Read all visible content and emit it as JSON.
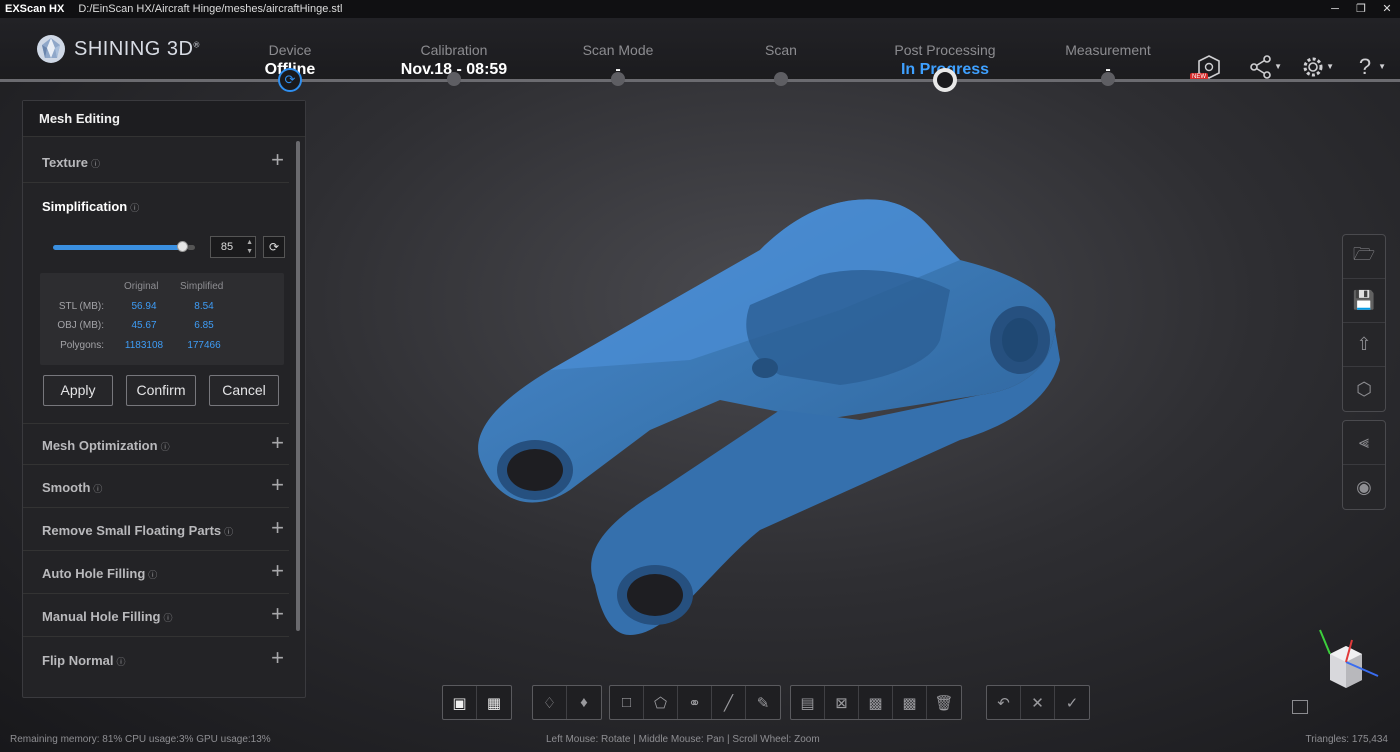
{
  "titlebar": {
    "app_name": "EXScan HX",
    "path": "D:/EinScan HX/Aircraft Hinge/meshes/aircraftHinge.stl",
    "controls": [
      "minimize-icon",
      "restore-icon",
      "close-icon"
    ]
  },
  "logo": {
    "text": "SHINING 3D",
    "mark": "®"
  },
  "workflow": {
    "steps": [
      {
        "label": "Device",
        "value": "Offline"
      },
      {
        "label": "Calibration",
        "value": "Nov.18 - 08:59"
      },
      {
        "label": "Scan Mode",
        "value": "-"
      },
      {
        "label": "Scan",
        "value": ""
      },
      {
        "label": "Post Processing",
        "value": "In Progress"
      },
      {
        "label": "Measurement",
        "value": "-"
      }
    ]
  },
  "top_icons": [
    {
      "icon": "new-features-icon",
      "badge": "NEW"
    },
    {
      "icon": "share-icon"
    },
    {
      "icon": "settings-gear-icon"
    },
    {
      "icon": "help-icon"
    }
  ],
  "panel": {
    "title": "Mesh Editing",
    "sections": [
      {
        "name": "Texture"
      },
      {
        "name": "Simplification"
      },
      {
        "name": "Mesh Optimization"
      },
      {
        "name": "Smooth"
      },
      {
        "name": "Remove Small Floating Parts"
      },
      {
        "name": "Auto Hole Filling"
      },
      {
        "name": "Manual Hole Filling"
      },
      {
        "name": "Flip Normal"
      }
    ],
    "simplification": {
      "slider_value": "85",
      "slider_fraction": 0.85,
      "headers": {
        "original": "Original",
        "simplified": "Simplified"
      },
      "rows": [
        {
          "label": "STL (MB):",
          "original": "56.94",
          "simplified": "8.54"
        },
        {
          "label": "OBJ (MB):",
          "original": "45.67",
          "simplified": "6.85"
        },
        {
          "label": "Polygons:",
          "original": "1183108",
          "simplified": "177466"
        }
      ],
      "buttons": {
        "apply": "Apply",
        "confirm": "Confirm",
        "cancel": "Cancel"
      }
    }
  },
  "right_toolbar": {
    "group1": [
      "open-folder-icon",
      "save-icon",
      "export-icon",
      "3d-box-icon"
    ],
    "group2": [
      "mirror-icon",
      "eye-icon"
    ]
  },
  "bottom_toolbar": {
    "groups": [
      [
        "view-perspective-icon",
        "view-box-icon"
      ],
      [
        "layers-icon",
        "layers-alt-icon"
      ],
      [
        "rect-select-icon",
        "poly-select-icon",
        "lasso-select-icon",
        "line-select-icon",
        "brush-select-icon"
      ],
      [
        "select-all-icon",
        "deselect-icon",
        "invert-select-icon",
        "select-connected-icon",
        "delete-icon"
      ],
      [
        "undo-icon",
        "cancel-icon",
        "apply-check-icon"
      ]
    ]
  },
  "status": {
    "left": "Remaining memory: 81% CPU usage:3%  GPU usage:13%",
    "center": "Left Mouse: Rotate | Middle Mouse: Pan | Scroll Wheel: Zoom",
    "right": "Triangles: 175,434"
  },
  "colors": {
    "accent": "#3ea0ff",
    "model": "#3b78b4",
    "background": "#2e2e32"
  }
}
